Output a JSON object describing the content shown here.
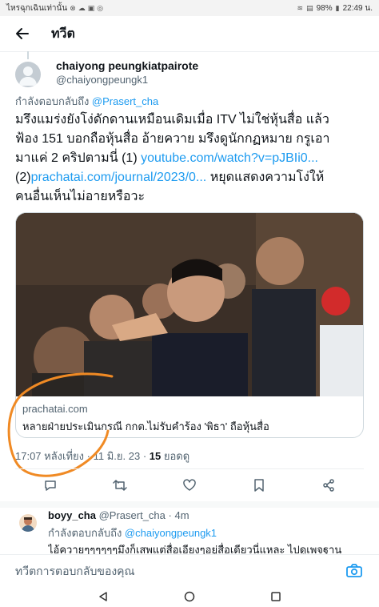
{
  "status_bar": {
    "notification_text": "ไหรฉุกเฉินเท่านั้น",
    "battery": "98%",
    "time": "22:49 น."
  },
  "header": {
    "title": "ทวีต"
  },
  "tweet": {
    "author_name": "chaiyong peungkiatpairote",
    "author_handle": "@chaiyongpeungk1",
    "replying_to_label": "กำลังตอบกลับถึง",
    "replying_to_handle": "@Prasert_cha",
    "text_line1": "มรึงแมร่งยังโง่ดักดานเหมือนเดิมเมื่อ ITV ไม่ใช่หุ้นสื่อ แล้ว",
    "text_line2": "ฟ้อง 151 บอกถือหุ้นสื่อ อ้ายควาย มรึงดูนักกฏหมาย กรูเอา",
    "text_line3_prefix": "มาแค่ 2 คริปตามนี่ (1) ",
    "link1": "youtube.com/watch?v=pJBIi0...",
    "text_line4_prefix": "(2)",
    "link2": "prachatai.com/journal/2023/0...",
    "text_line4_suffix": " หยุดแสดงความโง่ให้",
    "text_line5": "คนอื่นเห็นไม่อายหรือวะ",
    "card_domain": "prachatai.com",
    "card_title": "หลายฝ่ายประเมินกรณี กกต.ไม่รับคำร้อง 'พิธา' ถือหุ้นสื่อ",
    "time": "17:07 หลังเที่ยง",
    "date": "11 มิ.ย. 23",
    "view_count": "15",
    "view_label": "ยอดดู"
  },
  "reply": {
    "author_name": "boyy_cha",
    "author_handle": "@Prasert_cha",
    "age": "4m",
    "replying_to_label": "กำลังตอบกลับถึง",
    "replying_to_handle": "@chaiyongpeungk1",
    "text": "ไอ้ควายๆๆๆๆๆๆมึงก็เสพแต่สื่อเอียงๆอยู่สื่อเดียวนี่แหละ ไปดูเพจฐาน"
  },
  "compose": {
    "placeholder": "ทวีตการตอบกลับของคุณ"
  },
  "icons": {
    "back": "arrow-left-icon",
    "reply": "comment-icon",
    "retweet": "retweet-icon",
    "like": "heart-icon",
    "bookmark": "bookmark-icon",
    "share": "share-icon",
    "camera": "camera-icon",
    "nav_back": "triangle-back-icon",
    "nav_home": "circle-home-icon",
    "nav_recents": "square-recents-icon"
  },
  "colors": {
    "link": "#1d9bf0",
    "secondary_text": "#536471",
    "annotation": "#f08a24"
  }
}
